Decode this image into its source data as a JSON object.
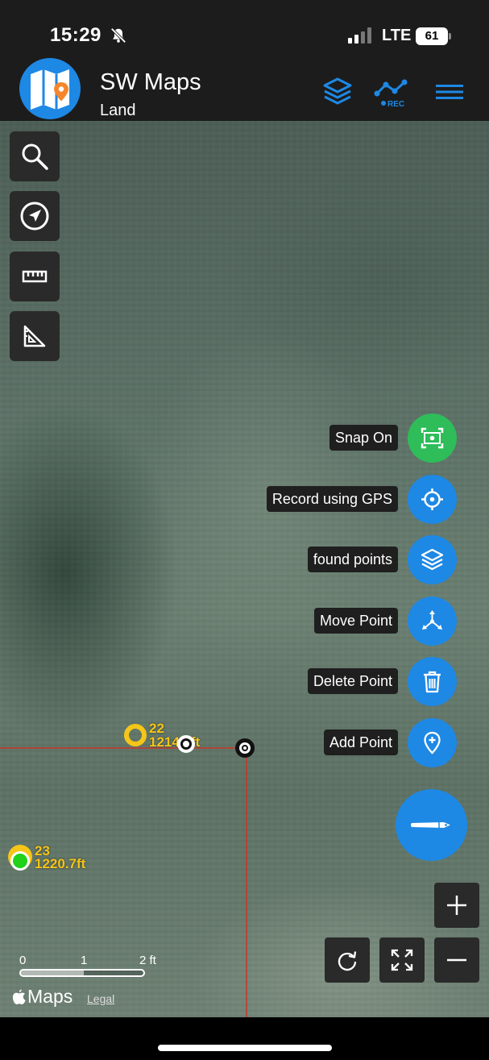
{
  "status_bar": {
    "time": "15:29",
    "network": "LTE",
    "battery": "61"
  },
  "app_bar": {
    "title": "SW Maps",
    "subtitle": "Land",
    "icons": {
      "logo": "map-pin-logo",
      "layers": "layers-icon",
      "record": "track-rec-icon",
      "menu": "hamburger-menu-icon"
    },
    "rec_badge": "REC"
  },
  "toolbar": {
    "items": [
      {
        "id": "search",
        "icon": "search-icon"
      },
      {
        "id": "navigate",
        "icon": "navigation-arrow-icon"
      },
      {
        "id": "measure-distance",
        "icon": "ruler-icon"
      },
      {
        "id": "measure-area",
        "icon": "set-square-icon"
      }
    ]
  },
  "fab_menu": {
    "items": [
      {
        "label": "Snap On",
        "icon": "snap-icon",
        "color": "#2ebd59"
      },
      {
        "label": "Record using GPS",
        "icon": "crosshair-icon",
        "color": "#1e88e5"
      },
      {
        "label": "found points",
        "icon": "layers-icon",
        "color": "#1e88e5"
      },
      {
        "label": "Move Point",
        "icon": "move-icon",
        "color": "#1e88e5"
      },
      {
        "label": "Delete Point",
        "icon": "trash-icon",
        "color": "#1e88e5"
      },
      {
        "label": "Add Point",
        "icon": "add-location-icon",
        "color": "#1e88e5"
      }
    ],
    "main_icon": "pencil-icon"
  },
  "map": {
    "points": [
      {
        "name": "22",
        "elevation": "1214.2ft",
        "color": "#f5c518"
      },
      {
        "name": "23",
        "elevation": "1220.7ft",
        "color": "#f5c518"
      }
    ],
    "gps_marker_color": "#22d11a",
    "scale": {
      "ticks": [
        "0",
        "1",
        "2 ft"
      ]
    },
    "attribution": {
      "brand": "Maps",
      "legal": "Legal"
    }
  },
  "map_controls": {
    "zoom_in": "plus-icon",
    "zoom_out": "minus-icon",
    "rotate": "rotate-icon",
    "fullscreen": "fullscreen-icon"
  }
}
